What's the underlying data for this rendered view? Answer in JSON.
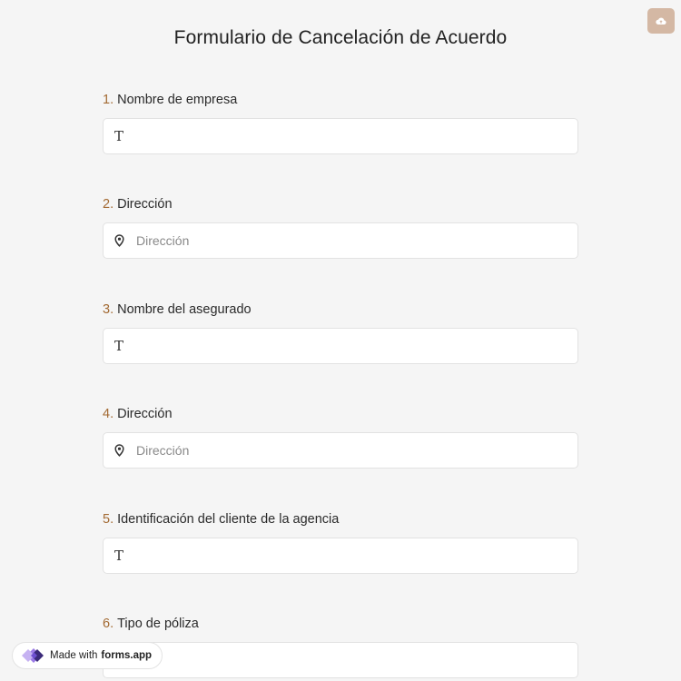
{
  "form": {
    "title": "Formulario de Cancelación de Acuerdo"
  },
  "toolbar": {
    "save_icon": "cloud-upload-icon"
  },
  "questions": [
    {
      "number": "1.",
      "label": "Nombre de empresa",
      "icon": "text-icon",
      "placeholder": ""
    },
    {
      "number": "2.",
      "label": "Dirección",
      "icon": "location-pin-icon",
      "placeholder": "Dirección"
    },
    {
      "number": "3.",
      "label": "Nombre del asegurado",
      "icon": "text-icon",
      "placeholder": ""
    },
    {
      "number": "4.",
      "label": "Dirección",
      "icon": "location-pin-icon",
      "placeholder": "Dirección"
    },
    {
      "number": "5.",
      "label": "Identificación del cliente de la agencia",
      "icon": "text-icon",
      "placeholder": ""
    },
    {
      "number": "6.",
      "label": "Tipo de póliza",
      "icon": "text-icon",
      "placeholder": ""
    }
  ],
  "branding": {
    "prefix": "Made with",
    "name": "forms.app"
  },
  "colors": {
    "background": "#f5f5f5",
    "accent_number": "#a36a33",
    "save_button": "#d4b8a4"
  }
}
